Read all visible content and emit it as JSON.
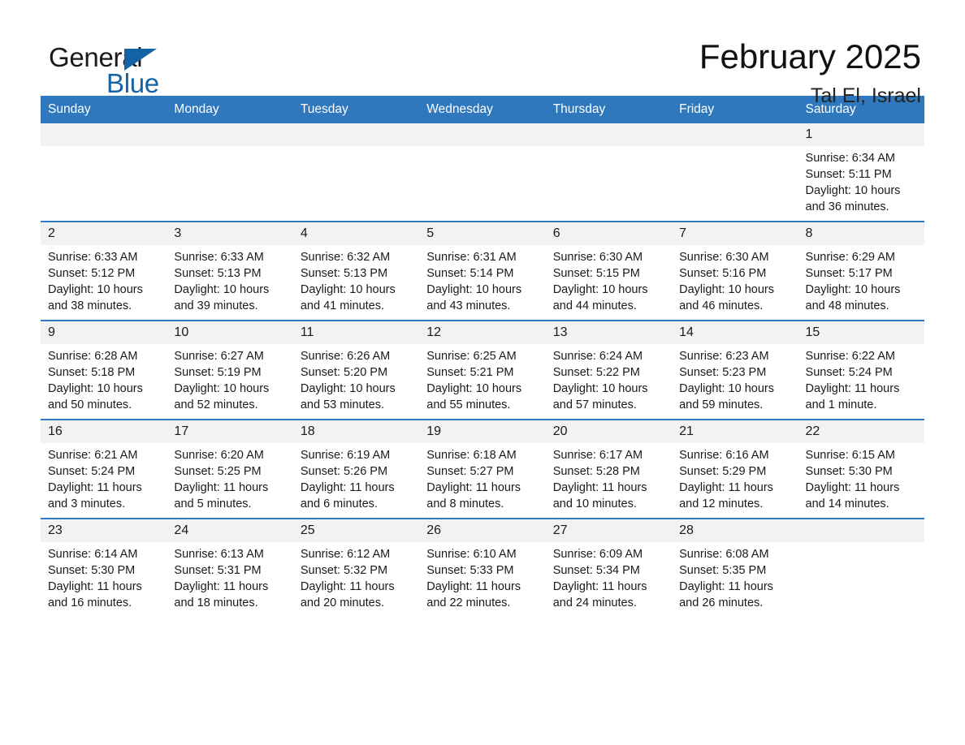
{
  "brand": {
    "name_top": "General",
    "name_bottom": "Blue",
    "accent_color": "#1464a5"
  },
  "header": {
    "title": "February 2025",
    "location": "Tal El, Israel"
  },
  "theme": {
    "header_row_bg": "#2f78bd",
    "daynum_bg": "#f2f2f2",
    "page_bg": "#ffffff",
    "text": "#1a1a1a"
  },
  "weekday_headers": [
    "Sunday",
    "Monday",
    "Tuesday",
    "Wednesday",
    "Thursday",
    "Friday",
    "Saturday"
  ],
  "weeks": [
    [
      {
        "day": "",
        "blank": true
      },
      {
        "day": "",
        "blank": true
      },
      {
        "day": "",
        "blank": true
      },
      {
        "day": "",
        "blank": true
      },
      {
        "day": "",
        "blank": true
      },
      {
        "day": "",
        "blank": true
      },
      {
        "day": "1",
        "sunrise": "Sunrise: 6:34 AM",
        "sunset": "Sunset: 5:11 PM",
        "daylight_line1": "Daylight: 10 hours",
        "daylight_line2": "and 36 minutes."
      }
    ],
    [
      {
        "day": "2",
        "sunrise": "Sunrise: 6:33 AM",
        "sunset": "Sunset: 5:12 PM",
        "daylight_line1": "Daylight: 10 hours",
        "daylight_line2": "and 38 minutes."
      },
      {
        "day": "3",
        "sunrise": "Sunrise: 6:33 AM",
        "sunset": "Sunset: 5:13 PM",
        "daylight_line1": "Daylight: 10 hours",
        "daylight_line2": "and 39 minutes."
      },
      {
        "day": "4",
        "sunrise": "Sunrise: 6:32 AM",
        "sunset": "Sunset: 5:13 PM",
        "daylight_line1": "Daylight: 10 hours",
        "daylight_line2": "and 41 minutes."
      },
      {
        "day": "5",
        "sunrise": "Sunrise: 6:31 AM",
        "sunset": "Sunset: 5:14 PM",
        "daylight_line1": "Daylight: 10 hours",
        "daylight_line2": "and 43 minutes."
      },
      {
        "day": "6",
        "sunrise": "Sunrise: 6:30 AM",
        "sunset": "Sunset: 5:15 PM",
        "daylight_line1": "Daylight: 10 hours",
        "daylight_line2": "and 44 minutes."
      },
      {
        "day": "7",
        "sunrise": "Sunrise: 6:30 AM",
        "sunset": "Sunset: 5:16 PM",
        "daylight_line1": "Daylight: 10 hours",
        "daylight_line2": "and 46 minutes."
      },
      {
        "day": "8",
        "sunrise": "Sunrise: 6:29 AM",
        "sunset": "Sunset: 5:17 PM",
        "daylight_line1": "Daylight: 10 hours",
        "daylight_line2": "and 48 minutes."
      }
    ],
    [
      {
        "day": "9",
        "sunrise": "Sunrise: 6:28 AM",
        "sunset": "Sunset: 5:18 PM",
        "daylight_line1": "Daylight: 10 hours",
        "daylight_line2": "and 50 minutes."
      },
      {
        "day": "10",
        "sunrise": "Sunrise: 6:27 AM",
        "sunset": "Sunset: 5:19 PM",
        "daylight_line1": "Daylight: 10 hours",
        "daylight_line2": "and 52 minutes."
      },
      {
        "day": "11",
        "sunrise": "Sunrise: 6:26 AM",
        "sunset": "Sunset: 5:20 PM",
        "daylight_line1": "Daylight: 10 hours",
        "daylight_line2": "and 53 minutes."
      },
      {
        "day": "12",
        "sunrise": "Sunrise: 6:25 AM",
        "sunset": "Sunset: 5:21 PM",
        "daylight_line1": "Daylight: 10 hours",
        "daylight_line2": "and 55 minutes."
      },
      {
        "day": "13",
        "sunrise": "Sunrise: 6:24 AM",
        "sunset": "Sunset: 5:22 PM",
        "daylight_line1": "Daylight: 10 hours",
        "daylight_line2": "and 57 minutes."
      },
      {
        "day": "14",
        "sunrise": "Sunrise: 6:23 AM",
        "sunset": "Sunset: 5:23 PM",
        "daylight_line1": "Daylight: 10 hours",
        "daylight_line2": "and 59 minutes."
      },
      {
        "day": "15",
        "sunrise": "Sunrise: 6:22 AM",
        "sunset": "Sunset: 5:24 PM",
        "daylight_line1": "Daylight: 11 hours",
        "daylight_line2": "and 1 minute."
      }
    ],
    [
      {
        "day": "16",
        "sunrise": "Sunrise: 6:21 AM",
        "sunset": "Sunset: 5:24 PM",
        "daylight_line1": "Daylight: 11 hours",
        "daylight_line2": "and 3 minutes."
      },
      {
        "day": "17",
        "sunrise": "Sunrise: 6:20 AM",
        "sunset": "Sunset: 5:25 PM",
        "daylight_line1": "Daylight: 11 hours",
        "daylight_line2": "and 5 minutes."
      },
      {
        "day": "18",
        "sunrise": "Sunrise: 6:19 AM",
        "sunset": "Sunset: 5:26 PM",
        "daylight_line1": "Daylight: 11 hours",
        "daylight_line2": "and 6 minutes."
      },
      {
        "day": "19",
        "sunrise": "Sunrise: 6:18 AM",
        "sunset": "Sunset: 5:27 PM",
        "daylight_line1": "Daylight: 11 hours",
        "daylight_line2": "and 8 minutes."
      },
      {
        "day": "20",
        "sunrise": "Sunrise: 6:17 AM",
        "sunset": "Sunset: 5:28 PM",
        "daylight_line1": "Daylight: 11 hours",
        "daylight_line2": "and 10 minutes."
      },
      {
        "day": "21",
        "sunrise": "Sunrise: 6:16 AM",
        "sunset": "Sunset: 5:29 PM",
        "daylight_line1": "Daylight: 11 hours",
        "daylight_line2": "and 12 minutes."
      },
      {
        "day": "22",
        "sunrise": "Sunrise: 6:15 AM",
        "sunset": "Sunset: 5:30 PM",
        "daylight_line1": "Daylight: 11 hours",
        "daylight_line2": "and 14 minutes."
      }
    ],
    [
      {
        "day": "23",
        "sunrise": "Sunrise: 6:14 AM",
        "sunset": "Sunset: 5:30 PM",
        "daylight_line1": "Daylight: 11 hours",
        "daylight_line2": "and 16 minutes."
      },
      {
        "day": "24",
        "sunrise": "Sunrise: 6:13 AM",
        "sunset": "Sunset: 5:31 PM",
        "daylight_line1": "Daylight: 11 hours",
        "daylight_line2": "and 18 minutes."
      },
      {
        "day": "25",
        "sunrise": "Sunrise: 6:12 AM",
        "sunset": "Sunset: 5:32 PM",
        "daylight_line1": "Daylight: 11 hours",
        "daylight_line2": "and 20 minutes."
      },
      {
        "day": "26",
        "sunrise": "Sunrise: 6:10 AM",
        "sunset": "Sunset: 5:33 PM",
        "daylight_line1": "Daylight: 11 hours",
        "daylight_line2": "and 22 minutes."
      },
      {
        "day": "27",
        "sunrise": "Sunrise: 6:09 AM",
        "sunset": "Sunset: 5:34 PM",
        "daylight_line1": "Daylight: 11 hours",
        "daylight_line2": "and 24 minutes."
      },
      {
        "day": "28",
        "sunrise": "Sunrise: 6:08 AM",
        "sunset": "Sunset: 5:35 PM",
        "daylight_line1": "Daylight: 11 hours",
        "daylight_line2": "and 26 minutes."
      },
      {
        "day": "",
        "blank": true
      }
    ]
  ]
}
